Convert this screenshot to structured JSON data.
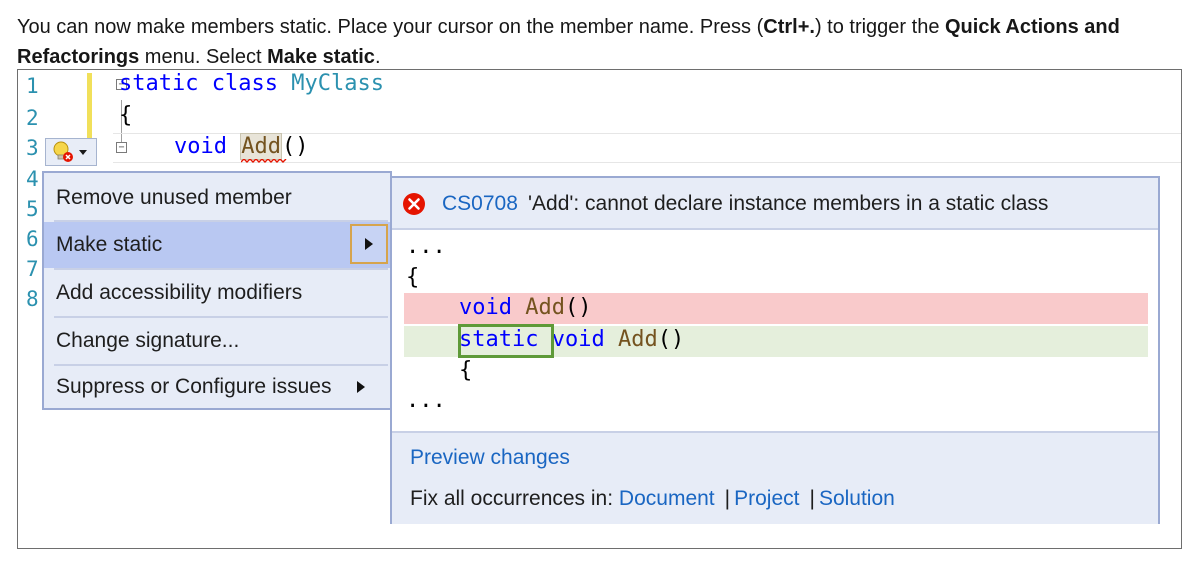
{
  "intro": {
    "part1": "You can now make members static. Place your cursor on the member name. Press (",
    "shortcut": "Ctrl+.",
    "part2": ") to trigger the ",
    "menu_name": "Quick Actions and Refactorings",
    "part3": " menu. Select ",
    "action": "Make static",
    "part4": "."
  },
  "editor": {
    "line_numbers": [
      "1",
      "2",
      "3",
      "4",
      "5",
      "6",
      "7",
      "8"
    ],
    "line1": {
      "keyword1": "static",
      "keyword2": "class",
      "type": "MyClass"
    },
    "line2": "{",
    "line3": {
      "keyword": "void",
      "method": "Add",
      "parens": "()"
    },
    "fold_minus": "−"
  },
  "quick_actions_menu": {
    "items": [
      {
        "label": "Remove unused member"
      },
      {
        "label": "Make static"
      },
      {
        "label": "Add accessibility modifiers"
      },
      {
        "label": "Change signature..."
      },
      {
        "label": "Suppress or Configure issues"
      }
    ]
  },
  "preview": {
    "error_code": "CS0708",
    "error_message": "'Add': cannot declare instance members in a static class",
    "diff": {
      "ellipsis_top": "...",
      "brace_open": "{",
      "removed": {
        "keyword": "void",
        "method": "Add",
        "parens": "()"
      },
      "added": {
        "keyword1": "static",
        "keyword2": "void",
        "method": "Add",
        "parens": "()"
      },
      "brace_next": "{",
      "ellipsis_bottom": "..."
    },
    "preview_changes_label": "Preview changes",
    "fix_all_label": "Fix all occurrences in:",
    "scopes": [
      "Document",
      "Project",
      "Solution"
    ],
    "separator": "|"
  },
  "colors": {
    "keyword": "#0000ff",
    "type": "#2b91af",
    "identifier": "#74531f",
    "link": "#1a66c2",
    "error": "#e51400",
    "removed_bg": "#f9cacb",
    "added_bg": "#e5efdc"
  },
  "icons": {
    "lightbulb": "lightbulb-error-icon",
    "error": "error-circle-icon",
    "submenu": "submenu-arrow-icon"
  }
}
